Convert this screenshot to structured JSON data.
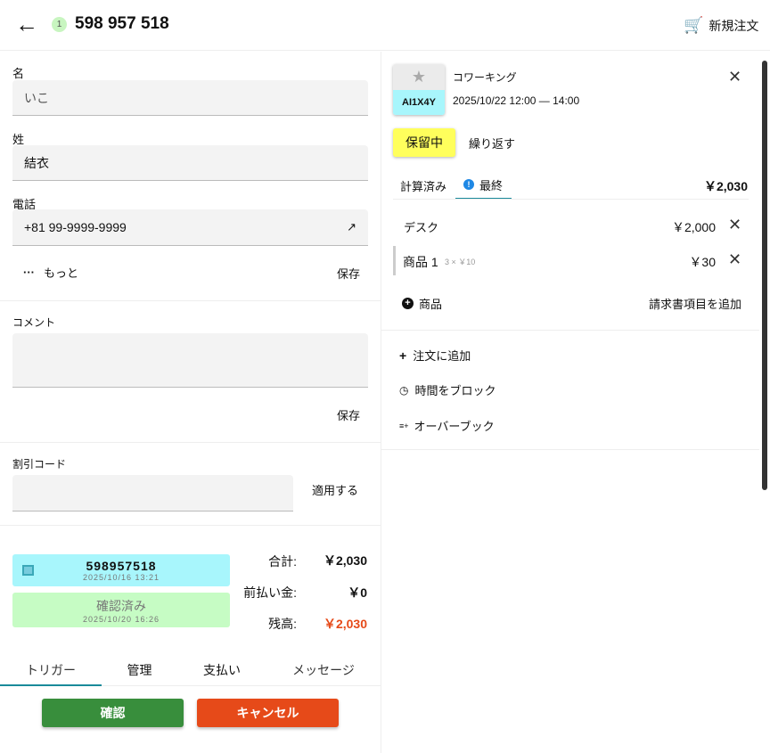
{
  "header": {
    "order_number": "598 957 518",
    "badge_count": "1",
    "new_order": "新規注文"
  },
  "form": {
    "first_name": {
      "label": "名",
      "value": "いこ"
    },
    "last_name": {
      "label": "姓",
      "value": "結衣"
    },
    "phone": {
      "label": "電話",
      "value": "+81 99-9999-9999"
    },
    "more": "もっと",
    "save": "保存",
    "comment": {
      "label": "コメント",
      "value": ""
    },
    "comment_save": "保存",
    "discount": {
      "label": "割引コード",
      "value": "",
      "apply": "適用する"
    }
  },
  "order_status": {
    "invoice": {
      "number": "598957518",
      "date": "2025/10/16 13:21"
    },
    "confirmed": {
      "label": "確認済み",
      "date": "2025/10/20 16:26"
    }
  },
  "totals": {
    "total_label": "合計:",
    "total": "￥2,030",
    "prepaid_label": "前払い金:",
    "prepaid": "￥0",
    "balance_label": "残高:",
    "balance": "￥2,030"
  },
  "tabs": [
    "トリガー",
    "管理",
    "支払い",
    "メッセージ"
  ],
  "actions": {
    "confirm": "確認",
    "cancel": "キャンセル"
  },
  "booking": {
    "code": "AI1X4Y",
    "resource": "コワーキング",
    "datetime": "2025/10/22 12:00 — 14:00",
    "status": "保留中",
    "repeat": "繰り返す",
    "price_tabs": [
      "計算済み",
      "最終"
    ],
    "price_total": "￥2,030",
    "items": [
      {
        "name": "デスク",
        "detail": "",
        "price": "￥2,000"
      },
      {
        "name": "商品 1",
        "detail": "3 × ￥10",
        "price": "￥30"
      }
    ],
    "add_product": "商品",
    "add_invoice_item": "請求書項目を追加",
    "menu": [
      "注文に追加",
      "時間をブロック",
      "オーバーブック"
    ]
  },
  "colors": {
    "accent": "#1a8a9a",
    "confirm": "#388e3c",
    "cancel": "#e64a19",
    "balance": "#e64a19",
    "status": "#ffff5c"
  }
}
